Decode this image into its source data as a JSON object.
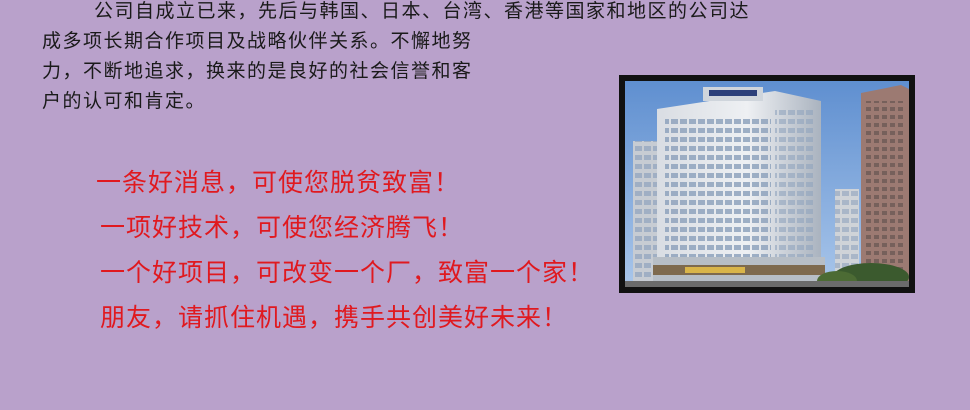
{
  "intro": {
    "line1": "公司自成立已来，先后与韩国、日本、台湾、香港等国家和地区的公司达",
    "line2": "成多项长期合作项目及战略伙伴关系。不懈地努",
    "line3": "力，不断地追求，换来的是良好的社会信誉和客",
    "line4": "户的认可和肯定。"
  },
  "slogans": [
    "一条好消息，可使您脱贫致富！",
    "一项好技术，可使您经济腾飞！",
    "一个好项目，可改变一个厂，致富一个家！",
    "朋友，请抓住机遇，携手共创美好未来！"
  ],
  "colors": {
    "background": "#b9a1cb",
    "slogan": "#e0191f",
    "text": "#1a1a1a"
  }
}
